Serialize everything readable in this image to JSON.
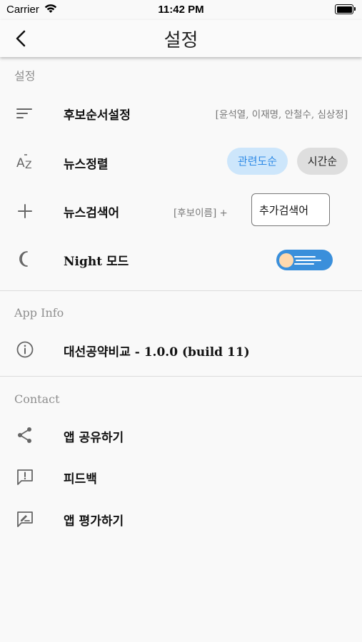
{
  "status_bar": {
    "carrier": "Carrier",
    "time": "11:42 PM"
  },
  "nav": {
    "title": "설정"
  },
  "sections": {
    "settings": "설정",
    "app_info": "App Info",
    "contact": "Contact"
  },
  "settings": {
    "candidate_order": {
      "label": "후보순서설정",
      "value": "[윤석열, 이재명, 안철수, 심상정]"
    },
    "news_sort": {
      "label": "뉴스정렬",
      "options": [
        "관련도순",
        "시간순"
      ],
      "selected": "관련도순"
    },
    "news_keyword": {
      "label": "뉴스검색어",
      "prefix": "[후보이름] +",
      "input_value": "추가검색어"
    },
    "night_mode": {
      "label": "Night 모드",
      "enabled": true
    }
  },
  "app_info": {
    "version_label": "대선공약비교 - 1.0.0 (build 11)"
  },
  "contact": {
    "share": "앱 공유하기",
    "feedback": "피드백",
    "rate": "앱 평가하기"
  },
  "colors": {
    "accent": "#3a8fdb",
    "pill_active_bg": "#cde6fb",
    "pill_active_text": "#2e8ae6"
  }
}
